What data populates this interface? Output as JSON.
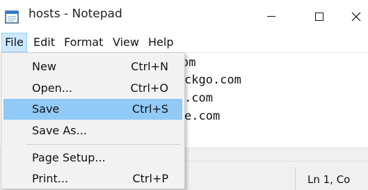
{
  "window": {
    "title": "hosts - Notepad"
  },
  "menubar": {
    "items": [
      "File",
      "Edit",
      "Format",
      "View",
      "Help"
    ]
  },
  "editor": {
    "lines": [
      "om",
      "ckgo.com",
      ".com",
      "e.com"
    ]
  },
  "statusbar": {
    "position": "Ln 1, Co"
  },
  "file_menu": {
    "items": [
      {
        "label": "New",
        "shortcut": "Ctrl+N"
      },
      {
        "label": "Open...",
        "shortcut": "Ctrl+O"
      },
      {
        "label": "Save",
        "shortcut": "Ctrl+S"
      },
      {
        "label": "Save As...",
        "shortcut": ""
      },
      {
        "label": "Page Setup...",
        "shortcut": ""
      },
      {
        "label": "Print...",
        "shortcut": "Ctrl+P"
      }
    ],
    "highlighted": "Save"
  },
  "colors": {
    "menu_highlight": "#91c9f7",
    "menubar_active": "#cce8ff"
  }
}
